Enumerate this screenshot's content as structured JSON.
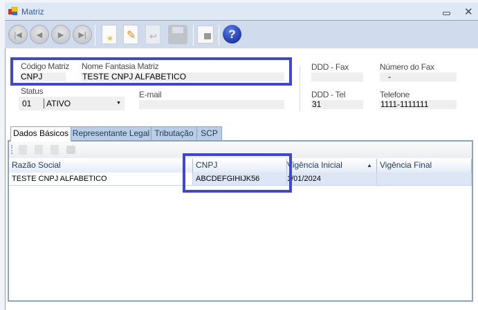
{
  "window": {
    "title": "Matriz"
  },
  "toolbar": {
    "buttons": [
      "first-icon",
      "previous-icon",
      "next-icon",
      "last-icon",
      "new-icon",
      "edit-icon",
      "undo-icon",
      "save-icon",
      "lock-icon",
      "help-icon"
    ]
  },
  "form": {
    "codigo_label": "Código Matriz",
    "codigo_value": "CNPJ",
    "nome_label": "Nome Fantasia Matriz",
    "nome_value": "TESTE CNPJ ALFABETICO",
    "status_label": "Status",
    "status_code": "01",
    "status_value": "ATIVO",
    "email_label": "E-mail",
    "email_value": "",
    "ddd_fax_label": "DDD - Fax",
    "ddd_fax_value": "",
    "fax_label": "Número do Fax",
    "fax_value": "-",
    "ddd_tel_label": "DDD - Tel",
    "ddd_tel_value": "31",
    "tel_label": "Telefone",
    "tel_value": "1111-1111111"
  },
  "tabs": [
    {
      "label": "Dados Básicos",
      "selected": true
    },
    {
      "label": "Representante Legal"
    },
    {
      "label": "Tributação"
    },
    {
      "label": "SCP"
    }
  ],
  "grid": {
    "columns": [
      "Razão Social",
      "CNPJ",
      "Vigência Inicial",
      "Vigência Final"
    ],
    "sort_indicator": "▲",
    "rows": [
      [
        "TESTE CNPJ ALFABETICO",
        "ABCDEFGIHIJK56",
        "1/01/2024",
        ""
      ]
    ]
  },
  "colors": {
    "highlight": "#3f48cc",
    "toolbar": "#d0dcee",
    "titlebar": "#dfe9f5"
  }
}
